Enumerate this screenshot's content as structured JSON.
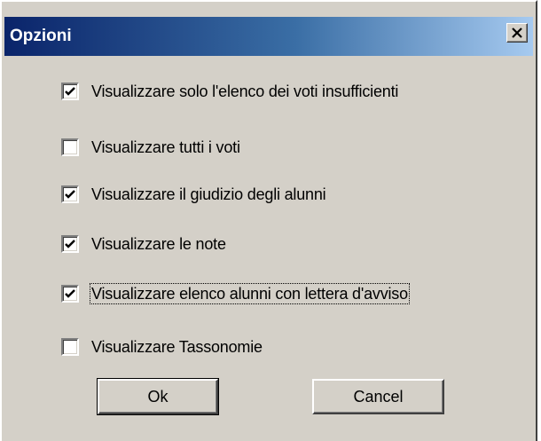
{
  "dialog": {
    "title": "Opzioni"
  },
  "options": [
    {
      "label": "Visualizzare solo l'elenco dei voti insufficienti",
      "checked": true
    },
    {
      "label": "Visualizzare tutti i voti",
      "checked": false
    },
    {
      "label": "Visualizzare il giudizio degli alunni",
      "checked": true
    },
    {
      "label": "Visualizzare le note",
      "checked": true
    },
    {
      "label": "Visualizzare elenco alunni con lettera d'avviso",
      "checked": true,
      "focused": true
    },
    {
      "label": "Visualizzare Tassonomie",
      "checked": false
    }
  ],
  "buttons": {
    "ok_label": "Ok",
    "cancel_label": "Cancel"
  },
  "icons": {
    "close": "close-icon",
    "check": "checkmark-icon"
  },
  "colors": {
    "titlebar_start": "#0a246a",
    "titlebar_end": "#a6caf0",
    "dialog_face": "#d4d0c8"
  }
}
